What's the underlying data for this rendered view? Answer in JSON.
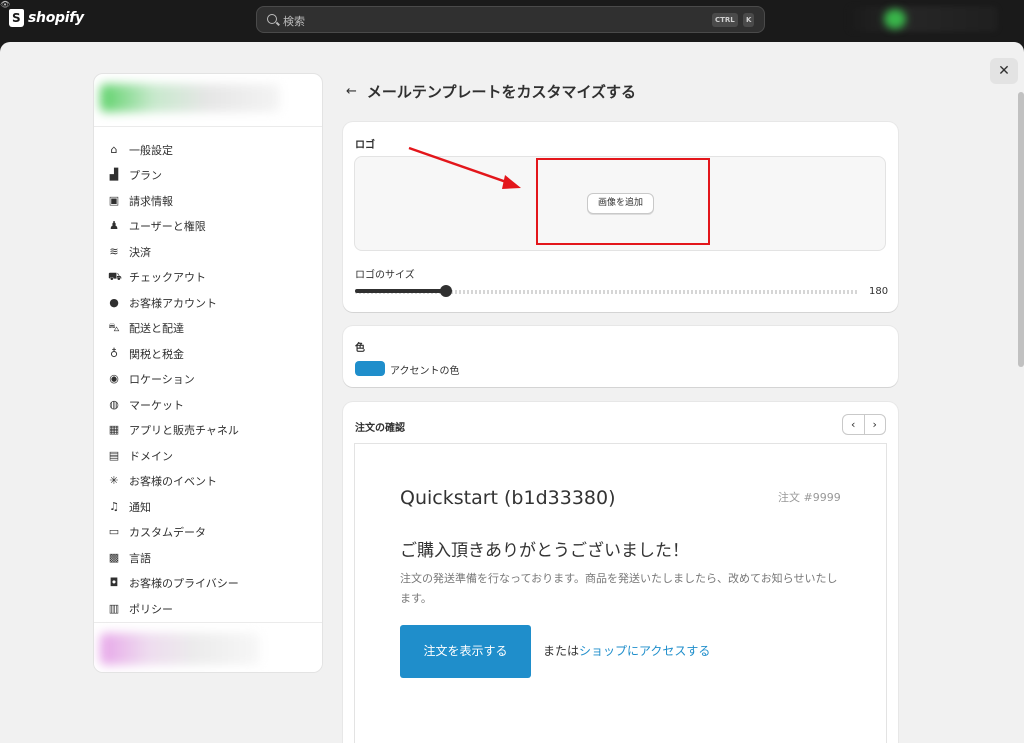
{
  "topbar": {
    "brand": "shopify",
    "search_placeholder": "検索",
    "shortcut_ctrl": "CTRL",
    "shortcut_k": "K"
  },
  "sidebar": {
    "items": [
      {
        "label": "一般設定",
        "icon": "store-icon"
      },
      {
        "label": "プラン",
        "icon": "chart-icon"
      },
      {
        "label": "請求情報",
        "icon": "billing-icon"
      },
      {
        "label": "ユーザーと権限",
        "icon": "users-icon"
      },
      {
        "label": "決済",
        "icon": "payment-icon"
      },
      {
        "label": "チェックアウト",
        "icon": "cart-icon"
      },
      {
        "label": "お客様アカウント",
        "icon": "person-icon"
      },
      {
        "label": "配送と配達",
        "icon": "truck-icon"
      },
      {
        "label": "関税と税金",
        "icon": "money-bag-icon"
      },
      {
        "label": "ロケーション",
        "icon": "location-icon"
      },
      {
        "label": "マーケット",
        "icon": "globe-icon"
      },
      {
        "label": "アプリと販売チャネル",
        "icon": "apps-icon"
      },
      {
        "label": "ドメイン",
        "icon": "domain-icon"
      },
      {
        "label": "お客様のイベント",
        "icon": "event-icon"
      },
      {
        "label": "通知",
        "icon": "bell-icon"
      },
      {
        "label": "カスタムデータ",
        "icon": "data-icon"
      },
      {
        "label": "言語",
        "icon": "language-icon"
      },
      {
        "label": "お客様のプライバシー",
        "icon": "lock-icon"
      },
      {
        "label": "ポリシー",
        "icon": "policy-icon"
      }
    ]
  },
  "main": {
    "title": "メールテンプレートをカスタマイズする",
    "logo_card": {
      "label": "ロゴ",
      "add_image_button": "画像を追加",
      "size_label": "ロゴのサイズ",
      "size_value": "180",
      "size_fraction": 0.18
    },
    "color_card": {
      "label": "色",
      "accent_label": "アクセントの色",
      "accent_color": "#1f8ecb"
    },
    "order_card": {
      "label": "注文の確認",
      "prev": "‹",
      "next": "›",
      "preview": {
        "shop_name": "Quickstart (b1d33380)",
        "order_number": "注文 #9999",
        "heading": "ご購入頂きありがとうございました！",
        "message": "注文の発送準備を行なっております。商品を発送いたしましたら、改めてお知らせいたします。",
        "view_order_button": "注文を表示する",
        "or_text": "または",
        "shop_link": "ショップにアクセスする"
      }
    }
  },
  "close_label": "✕"
}
